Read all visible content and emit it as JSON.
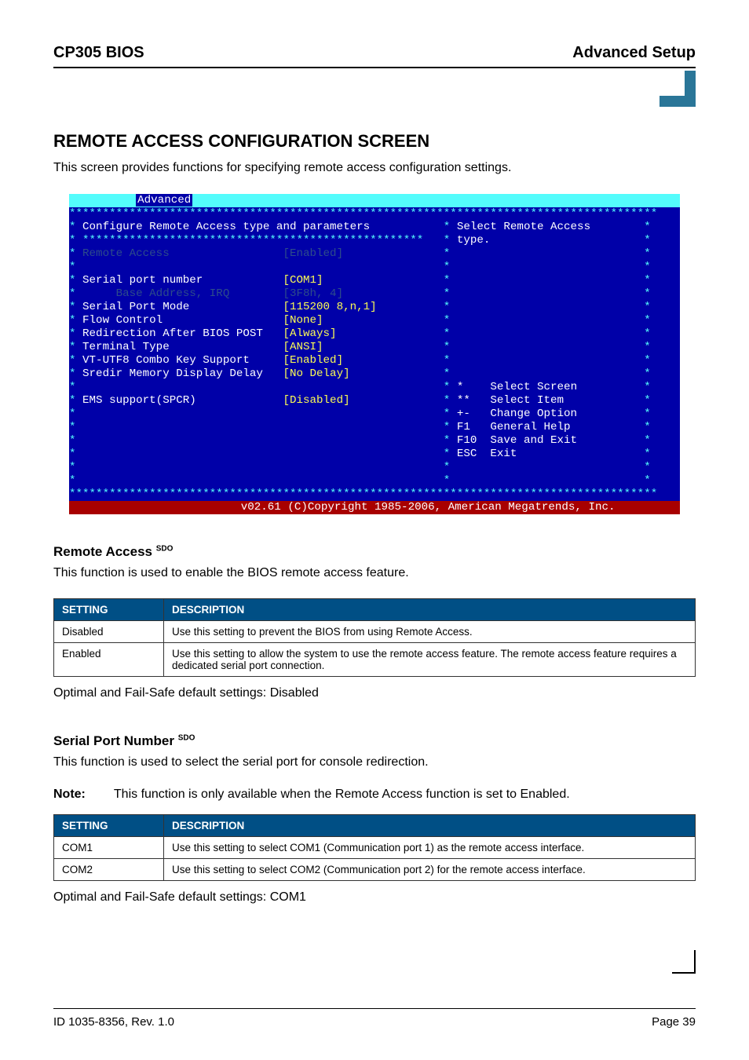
{
  "header": {
    "left": "CP305 BIOS",
    "right": "Advanced Setup"
  },
  "section_title": "REMOTE ACCESS CONFIGURATION SCREEN",
  "section_intro": "This screen provides functions for specifying remote access configuration settings.",
  "bios": {
    "tab_label": "Advanced",
    "star_line_full": "****************************************************************************************",
    "left_title": "Configure Remote Access type and parameters",
    "right_help1": "Select Remote Access",
    "right_help2": "type.",
    "inner_stars": "***************************************************",
    "rows": [
      {
        "label": "Remote Access",
        "value": "[Enabled]",
        "dim": true,
        "indent": 0
      },
      {
        "label": "",
        "value": "",
        "indent": 0
      },
      {
        "label": "Serial port number",
        "value": "[COM1]",
        "indent": 0
      },
      {
        "label": "Base Address, IRQ",
        "value": "[3F8h, 4]",
        "dim": true,
        "indent": 5
      },
      {
        "label": "Serial Port Mode",
        "value": "[115200 8,n,1]",
        "indent": 0
      },
      {
        "label": "Flow Control",
        "value": "[None]",
        "indent": 0
      },
      {
        "label": "Redirection After BIOS POST",
        "value": "[Always]",
        "indent": 0
      },
      {
        "label": "Terminal Type",
        "value": "[ANSI]",
        "indent": 0
      },
      {
        "label": "VT-UTF8 Combo Key Support",
        "value": "[Enabled]",
        "indent": 0
      },
      {
        "label": "Sredir Memory Display Delay",
        "value": "[No Delay]",
        "indent": 0
      },
      {
        "label": "",
        "value": "",
        "indent": 0
      },
      {
        "label": "EMS support(SPCR)",
        "value": "[Disabled]",
        "indent": 0
      }
    ],
    "nav": [
      {
        "key": "*",
        "text": "Select Screen"
      },
      {
        "key": "**",
        "text": "Select Item"
      },
      {
        "key": "+-",
        "text": "Change Option"
      },
      {
        "key": "F1",
        "text": "General Help"
      },
      {
        "key": "F10",
        "text": "Save and Exit"
      },
      {
        "key": "ESC",
        "text": "Exit"
      }
    ],
    "copyright": "v02.61 (C)Copyright 1985-2006, American Megatrends, Inc."
  },
  "remote_access": {
    "heading": "Remote Access",
    "sdo": "SDO",
    "intro": "This function is used to enable the BIOS remote access feature.",
    "th_setting": "SETTING",
    "th_desc": "DESCRIPTION",
    "rows": [
      {
        "setting": "Disabled",
        "desc": "Use this setting to prevent the BIOS from using Remote Access."
      },
      {
        "setting": "Enabled",
        "desc": "Use this setting to allow the system to use the remote access feature. The remote access feature requires a dedicated serial port connection."
      }
    ],
    "defaults": "Optimal and Fail-Safe default settings: Disabled"
  },
  "serial_port": {
    "heading": "Serial Port Number",
    "sdo": "SDO",
    "intro": "This function is used to select the serial port for console redirection.",
    "note_label": "Note:",
    "note_text": "This function is only available when the Remote Access function is set to Enabled.",
    "th_setting": "SETTING",
    "th_desc": "DESCRIPTION",
    "rows": [
      {
        "setting": "COM1",
        "desc": "Use this setting to select COM1 (Communication port 1) as the remote access interface."
      },
      {
        "setting": "COM2",
        "desc": "Use this setting to select COM2 (Communication port 2) for the remote access interface."
      }
    ],
    "defaults": "Optimal and Fail-Safe default settings: COM1"
  },
  "footer": {
    "left": "ID 1035-8356, Rev. 1.0",
    "right": "Page 39"
  }
}
